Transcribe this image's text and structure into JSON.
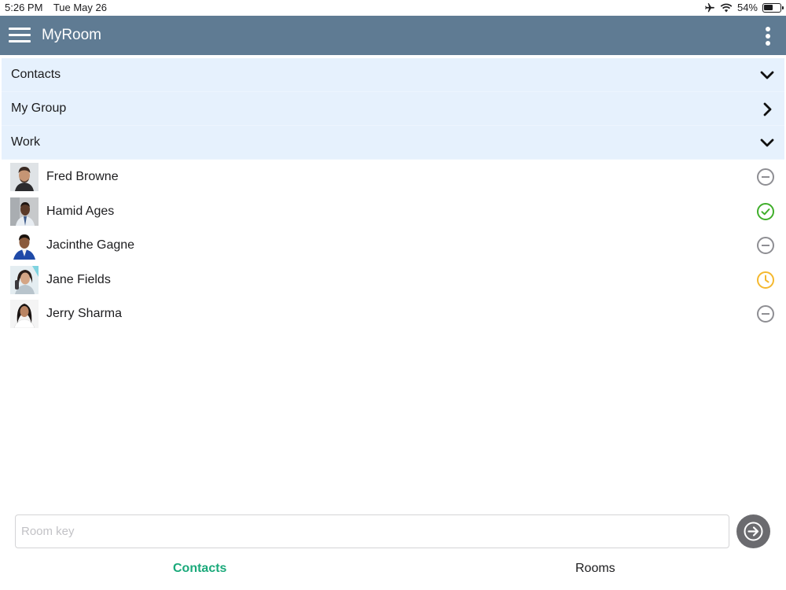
{
  "status_bar": {
    "time": "5:26 PM",
    "date": "Tue May 26",
    "battery": "54%",
    "battery_level": 0.54,
    "icons": [
      "airplane-mode-icon",
      "wifi-icon",
      "battery-icon"
    ]
  },
  "header": {
    "title": "MyRoom",
    "menu_icon": "hamburger-menu-icon",
    "more_icon": "vertical-ellipsis-icon"
  },
  "groups": [
    {
      "label": "Contacts",
      "state": "expanded"
    },
    {
      "label": "My Group",
      "state": "collapsed"
    },
    {
      "label": "Work",
      "state": "expanded"
    }
  ],
  "contacts": [
    {
      "name": "Fred Browne",
      "status": "offline",
      "status_icon": "minus-circle-icon"
    },
    {
      "name": "Hamid Ages",
      "status": "available",
      "status_icon": "check-circle-icon"
    },
    {
      "name": "Jacinthe Gagne",
      "status": "offline",
      "status_icon": "minus-circle-icon"
    },
    {
      "name": "Jane Fields",
      "status": "away",
      "status_icon": "clock-icon"
    },
    {
      "name": "Jerry Sharma",
      "status": "offline",
      "status_icon": "minus-circle-icon"
    }
  ],
  "room_key": {
    "placeholder": "Room key",
    "value": "",
    "submit_icon": "arrow-right-icon"
  },
  "tabs": [
    {
      "label": "Contacts",
      "active": true
    },
    {
      "label": "Rooms",
      "active": false
    }
  ],
  "colors": {
    "header_bg": "#5f7b93",
    "group_bg": "#e6f1fd",
    "active_tab": "#1aa97a",
    "available": "#3fae2a",
    "away": "#f5b82e",
    "offline": "#8e8e93"
  }
}
